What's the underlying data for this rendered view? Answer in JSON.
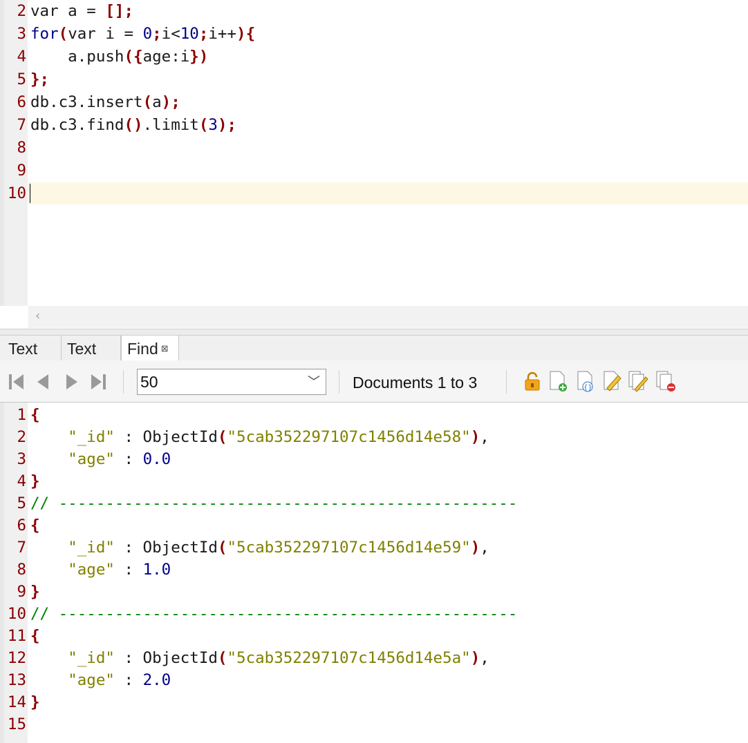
{
  "editor": {
    "lines": [
      {
        "n": "2",
        "text": "var a = [];"
      },
      {
        "n": "3",
        "text": "for(var i = 0;i<10;i++){"
      },
      {
        "n": "4",
        "text": "    a.push({age:i})"
      },
      {
        "n": "5",
        "text": "};"
      },
      {
        "n": "6",
        "text": "db.c3.insert(a);"
      },
      {
        "n": "7",
        "text": "db.c3.find().limit(3);"
      },
      {
        "n": "8",
        "text": ""
      },
      {
        "n": "9",
        "text": ""
      },
      {
        "n": "10",
        "text": ""
      }
    ]
  },
  "tabs": [
    {
      "label": "Text"
    },
    {
      "label": "Text"
    },
    {
      "label": "Find",
      "close": "⊠"
    }
  ],
  "toolbar": {
    "page_size": "50",
    "doc_range": "Documents 1 to 3",
    "icons": [
      "first-page-icon",
      "prev-page-icon",
      "next-page-icon",
      "last-page-icon",
      "lock-icon",
      "add-document-icon",
      "view-json-icon",
      "edit-document-icon",
      "edit-multiple-icon",
      "delete-documents-icon"
    ]
  },
  "results": {
    "lines": [
      {
        "n": "1",
        "text": "{"
      },
      {
        "n": "2",
        "text": "    \"_id\" : ObjectId(\"5cab352297107c1456d14e58\"),"
      },
      {
        "n": "3",
        "text": "    \"age\" : 0.0"
      },
      {
        "n": "4",
        "text": "}"
      },
      {
        "n": "5",
        "text": "// -------------------------------------------------"
      },
      {
        "n": "6",
        "text": "{"
      },
      {
        "n": "7",
        "text": "    \"_id\" : ObjectId(\"5cab352297107c1456d14e59\"),"
      },
      {
        "n": "8",
        "text": "    \"age\" : 1.0"
      },
      {
        "n": "9",
        "text": "}"
      },
      {
        "n": "10",
        "text": "// -------------------------------------------------"
      },
      {
        "n": "11",
        "text": "{"
      },
      {
        "n": "12",
        "text": "    \"_id\" : ObjectId(\"5cab352297107c1456d14e5a\"),"
      },
      {
        "n": "13",
        "text": "    \"age\" : 2.0"
      },
      {
        "n": "14",
        "text": "}"
      },
      {
        "n": "15",
        "text": ""
      }
    ]
  }
}
